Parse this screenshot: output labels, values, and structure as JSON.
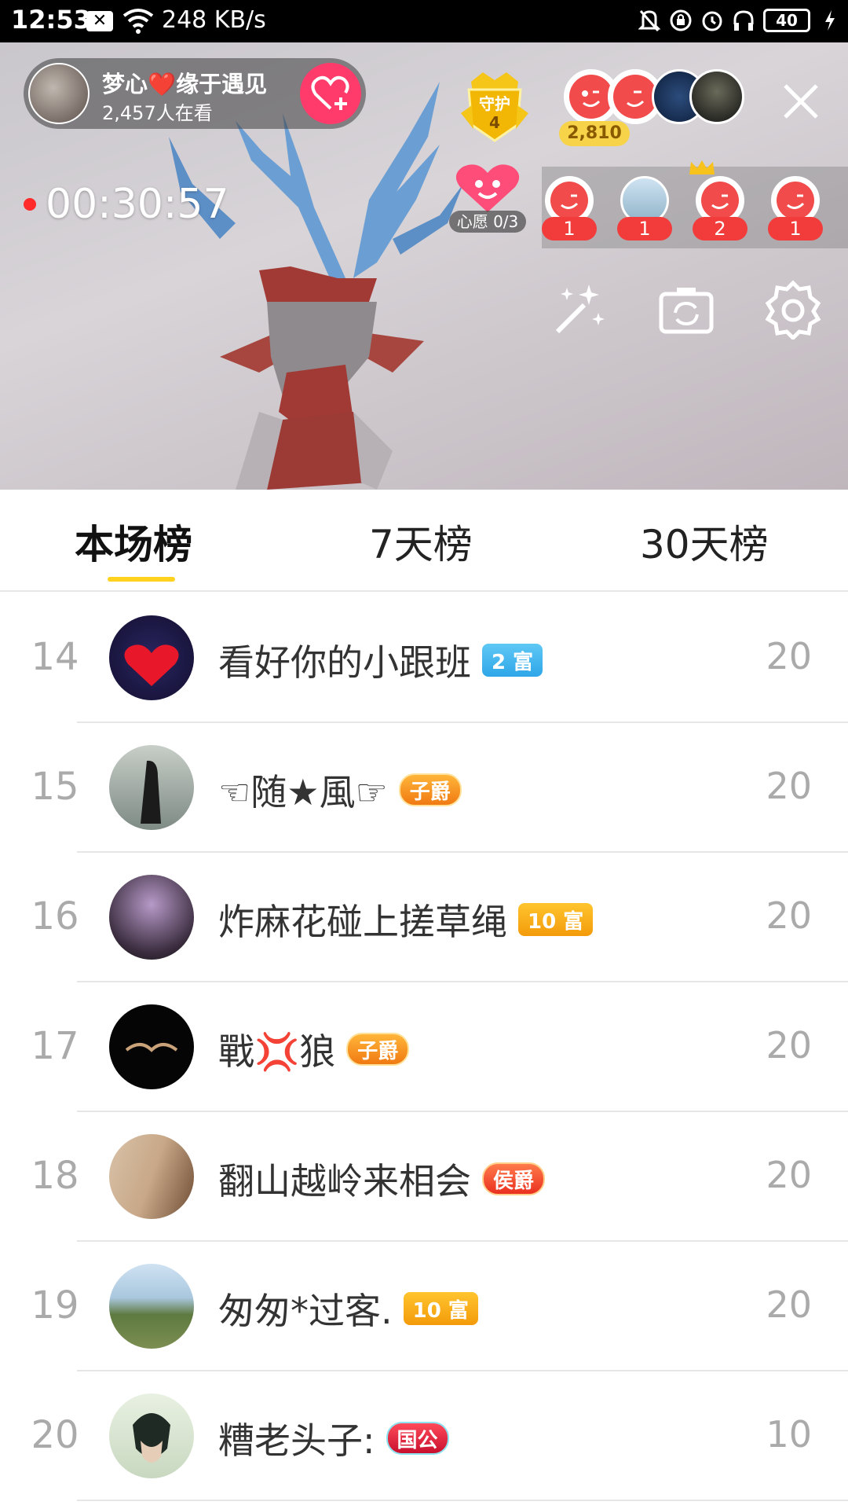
{
  "status_bar": {
    "time": "12:53",
    "network_speed": "248 KB/s",
    "battery": "40",
    "icons": [
      "notification-x-icon",
      "wifi-icon",
      "mute-icon",
      "lock-rotation-icon",
      "alarm-icon",
      "headphones-icon",
      "battery-icon",
      "charging-icon"
    ]
  },
  "live": {
    "host_name": "梦心❤️缘于遇见",
    "viewers": "2,457人在看",
    "guard_label": "守护",
    "guard_count": "4",
    "top_fans_count": "2,810",
    "duration": "00:30:57",
    "wish_label": "心愿 0/3",
    "gifts": [
      {
        "count": "1"
      },
      {
        "count": "1"
      },
      {
        "count": "2"
      },
      {
        "count": "1"
      }
    ],
    "tools": [
      "magic-wand-icon",
      "camera-flip-icon",
      "settings-icon"
    ]
  },
  "tabs": [
    {
      "label": "本场榜",
      "active": true
    },
    {
      "label": "7天榜",
      "active": false
    },
    {
      "label": "30天榜",
      "active": false
    }
  ],
  "ranking": [
    {
      "rank": "14",
      "name": "看好你的小跟班",
      "badge": "2 富",
      "badge_style": "blue",
      "score": "20"
    },
    {
      "rank": "15",
      "name": "☜随★風☞",
      "badge": "子爵",
      "badge_style": "noble-orange",
      "score": "20"
    },
    {
      "rank": "16",
      "name": "炸麻花碰上搓草绳",
      "badge": "10 富",
      "badge_style": "orange",
      "score": "20"
    },
    {
      "rank": "17",
      "name": "戰💢狼",
      "badge": "子爵",
      "badge_style": "noble-orange",
      "score": "20"
    },
    {
      "rank": "18",
      "name": "翻山越岭来相会",
      "badge": "侯爵",
      "badge_style": "noble-red",
      "score": "20"
    },
    {
      "rank": "19",
      "name": "匆匆*过客.",
      "badge": "10 富",
      "badge_style": "orange",
      "score": "20"
    },
    {
      "rank": "20",
      "name": "糟老头子:",
      "badge": "国公",
      "badge_style": "noble-crimson",
      "score": "10"
    }
  ],
  "colors": {
    "accent_yellow": "#ffd21f",
    "follow_pink": "#ff3b6b",
    "gift_red": "#f23b3b"
  }
}
